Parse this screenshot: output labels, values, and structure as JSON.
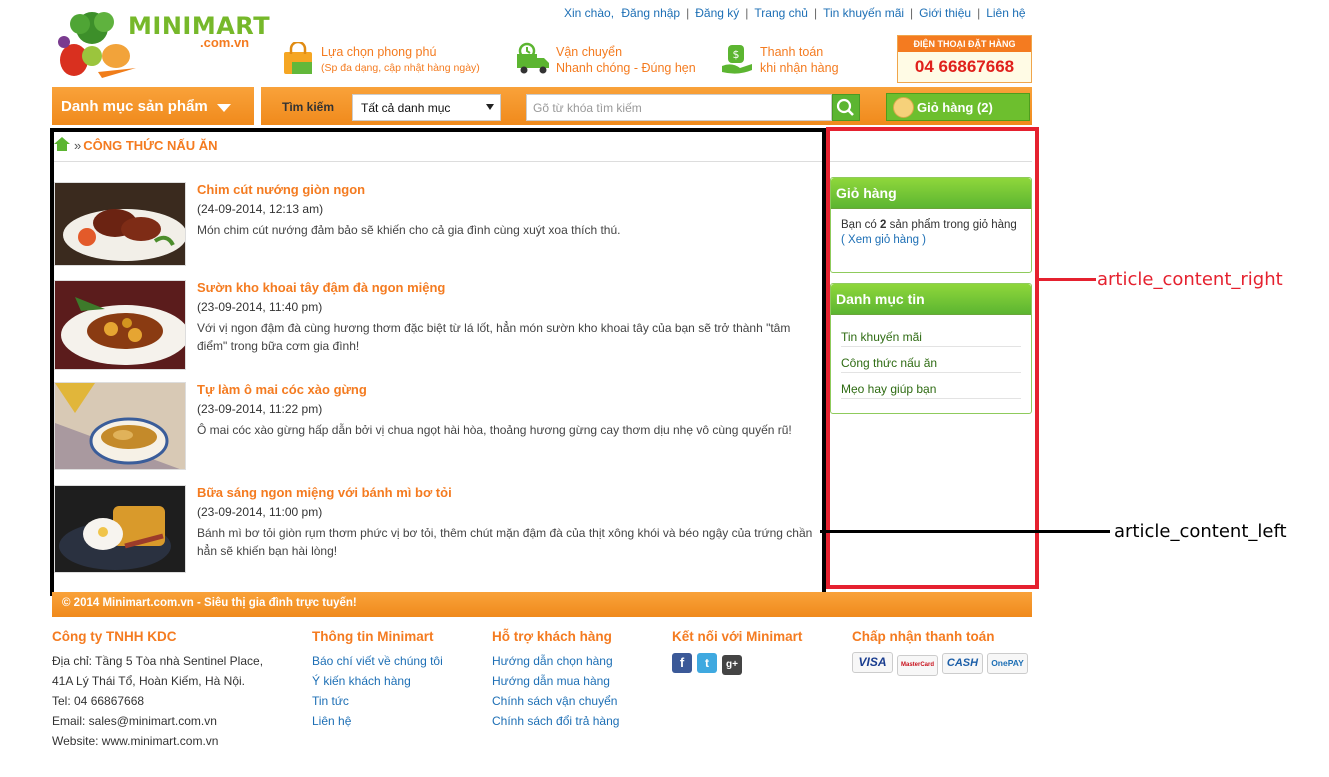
{
  "header": {
    "logo_text": "MINIMART",
    "logo_sub": ".com.vn",
    "top_links": [
      "Xin chào,",
      "Đăng nhập",
      "Đăng ký",
      "Trang chủ",
      "Tin khuyến mãi",
      "Giới thiệu",
      "Liên hệ"
    ],
    "features": [
      {
        "icon": "shopping-bag-icon",
        "line1": "Lựa chọn phong phú",
        "line2": "(Sp đa dạng, cập nhật hàng ngày)"
      },
      {
        "icon": "delivery-truck-icon",
        "line1": "Vận chuyển",
        "line2": "Nhanh chóng - Đúng hẹn"
      },
      {
        "icon": "money-hand-icon",
        "line1": "Thanh toán",
        "line2": "khi nhận hàng"
      }
    ],
    "hotline_label": "ĐIỆN THOẠI ĐẶT HÀNG",
    "hotline_number": "04 66867668"
  },
  "nav": {
    "category_label": "Danh mục sản phẩm",
    "search_label": "Tìm kiếm",
    "category_select": "Tất cả danh mục",
    "search_placeholder": "Gõ từ khóa tìm kiếm",
    "cart_label": "Giỏ hàng (2)"
  },
  "breadcrumb": {
    "sep": "»",
    "current": "CÔNG THỨC NẤU ĂN"
  },
  "articles": [
    {
      "title": "Chim cút nướng giòn ngon",
      "date": "(24-09-2014, 12:13 am)",
      "desc": "Món chim cút nướng đảm bảo sẽ khiến cho cả gia đình cùng xuýt xoa thích thú."
    },
    {
      "title": "Sườn kho khoai tây đậm đà ngon miệng",
      "date": "(23-09-2014, 11:40 pm)",
      "desc": "Với vị ngon đậm đà cùng hương thơm đặc biệt từ lá lốt, hẳn món sườn kho khoai tây của bạn sẽ trở thành \"tâm điểm\" trong bữa cơm gia đình!"
    },
    {
      "title": "Tự làm ô mai cóc xào gừng",
      "date": "(23-09-2014, 11:22 pm)",
      "desc": "Ô mai cóc xào gừng hấp dẫn bởi vị chua ngọt hài hòa, thoảng hương gừng cay thơm dịu nhẹ vô cùng quyến rũ!"
    },
    {
      "title": "Bữa sáng ngon miệng với bánh mì bơ tỏi",
      "date": "(23-09-2014, 11:00 pm)",
      "desc": "Bánh mì bơ tỏi giòn rụm thơm phức vị bơ tỏi, thêm chút mặn đậm đà của thịt xông khói và béo ngậy của trứng chần hẳn sẽ khiến bạn hài lòng!"
    }
  ],
  "sidebar": {
    "cart_title": "Giỏ hàng",
    "cart_text_pre": "Bạn có ",
    "cart_count": "2",
    "cart_text_post": " sản phẩm trong giỏ hàng",
    "cart_link": "( Xem giỏ hàng )",
    "news_title": "Danh mục tin",
    "news_items": [
      "Tin khuyến mãi",
      "Công thức nấu ăn",
      "Mẹo hay giúp bạn"
    ]
  },
  "annotations": {
    "right": "article_content_right",
    "left": "article_content_left"
  },
  "footer": {
    "copyright": "© 2014 Minimart.com.vn - Siêu thị gia đình trực tuyến!",
    "company": {
      "title": "Công ty TNHH KDC",
      "lines": [
        "Địa chỉ: Tầng 5 Tòa nhà Sentinel Place,",
        "41A Lý Thái Tổ, Hoàn Kiếm, Hà Nội.",
        "Tel: 04 66867668",
        "Email: sales@minimart.com.vn",
        "Website: www.minimart.com.vn"
      ]
    },
    "info": {
      "title": "Thông tin Minimart",
      "links": [
        "Báo chí viết về chúng tôi",
        "Ý kiến khách hàng",
        "Tin tức",
        "Liên hệ"
      ]
    },
    "support": {
      "title": "Hỗ trợ khách hàng",
      "links": [
        "Hướng dẫn chọn hàng",
        "Hướng dẫn mua hàng",
        "Chính sách vận chuyển",
        "Chính sách đổi trả hàng"
      ]
    },
    "social": {
      "title": "Kết nối với Minimart",
      "icons": [
        "f",
        "t",
        "g+"
      ]
    },
    "payment": {
      "title": "Chấp nhận thanh toán",
      "methods": [
        "VISA",
        "MasterCard",
        "CASH",
        "OnePAY"
      ]
    }
  },
  "colors": {
    "orange": "#f47b20",
    "green": "#5cb531",
    "red_annot": "#e5212f",
    "link_blue": "#1d6fb5"
  }
}
